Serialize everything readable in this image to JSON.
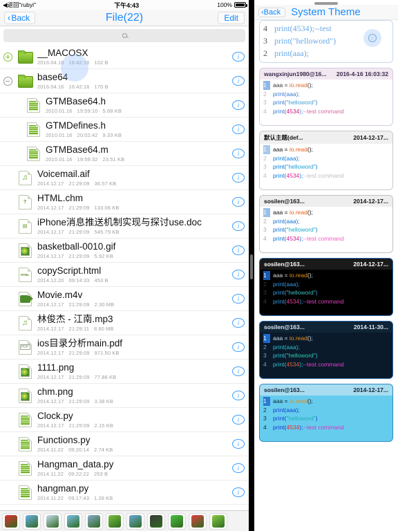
{
  "status_bar": {
    "back_label": "◀返回\"rubyi\"",
    "time": "下午4:43",
    "battery": "100%"
  },
  "left": {
    "nav": {
      "back": "Back",
      "title": "File(22)",
      "edit": "Edit"
    },
    "search": {
      "placeholder": "",
      "icon": "search-icon"
    },
    "files": [
      {
        "name": "__MACOSX",
        "date": "2016.04.16",
        "time": "16:42:16",
        "size": "102 B",
        "icon": "folder-icon",
        "toggle": "plus",
        "indent": 0
      },
      {
        "name": "base64",
        "date": "2016.04.16",
        "time": "16:42:16",
        "size": "170 B",
        "icon": "folder-icon",
        "toggle": "minus",
        "indent": 0
      },
      {
        "name": "GTMBase64.h",
        "date": "2010.01.16",
        "time": "19:59:10",
        "size": "5.68 KB",
        "icon": "code-file-icon",
        "toggle": "",
        "indent": 1
      },
      {
        "name": "GTMDefines.h",
        "date": "2010.01.16",
        "time": "20:02:42",
        "size": "9.33 KB",
        "icon": "code-file-icon",
        "toggle": "",
        "indent": 1
      },
      {
        "name": "GTMBase64.m",
        "date": "2010.01.16",
        "time": "19:59:32",
        "size": "23.51 KB",
        "icon": "code-file-icon",
        "toggle": "",
        "indent": 1
      },
      {
        "name": "Voicemail.aif",
        "date": "2014.12.17",
        "time": "21:29:09",
        "size": "36.57 KB",
        "icon": "audio-file-icon",
        "toggle": "",
        "indent": 0
      },
      {
        "name": "HTML.chm",
        "date": "2014.12.17",
        "time": "21:29:09",
        "size": "133.06 KB",
        "icon": "chm-file-icon",
        "toggle": "",
        "indent": 0
      },
      {
        "name": "iPhone消息推送机制实现与探讨use.doc",
        "date": "2014.12.17",
        "time": "21:29:09",
        "size": "545.79 KB",
        "icon": "doc-file-icon",
        "toggle": "",
        "indent": 0
      },
      {
        "name": "basketball-0010.gif",
        "date": "2014.12.17",
        "time": "21:29:09",
        "size": "5.92 KB",
        "icon": "image-file-icon",
        "toggle": "",
        "indent": 0
      },
      {
        "name": "copyScript.html",
        "date": "2014.12.20",
        "time": "09:14:33",
        "size": "453 B",
        "icon": "html-file-icon",
        "toggle": "",
        "indent": 0
      },
      {
        "name": "Movie.m4v",
        "date": "2014.12.17",
        "time": "21:29:09",
        "size": "2.30 MB",
        "icon": "video-file-icon",
        "toggle": "",
        "indent": 0
      },
      {
        "name": "林俊杰 - 江南.mp3",
        "date": "2014.12.17",
        "time": "21:29:11",
        "size": "8.60 MB",
        "icon": "audio-file-icon",
        "toggle": "",
        "indent": 0
      },
      {
        "name": "ios目录分析main.pdf",
        "date": "2014.12.17",
        "time": "21:29:09",
        "size": "971.50 KB",
        "icon": "pdf-file-icon",
        "toggle": "",
        "indent": 0
      },
      {
        "name": "1111.png",
        "date": "2014.12.17",
        "time": "21:29:09",
        "size": "77.88 KB",
        "icon": "image-file-icon",
        "toggle": "",
        "indent": 0
      },
      {
        "name": "chm.png",
        "date": "2014.12.17",
        "time": "21:29:09",
        "size": "3.38 KB",
        "icon": "image-file-icon",
        "toggle": "",
        "indent": 0
      },
      {
        "name": "Clock.py",
        "date": "2014.12.17",
        "time": "21:29:09",
        "size": "2.15 KB",
        "icon": "code-file-icon",
        "toggle": "",
        "indent": 0
      },
      {
        "name": "Functions.py",
        "date": "2014.11.22",
        "time": "09:20:14",
        "size": "2.74 KB",
        "icon": "code-file-icon",
        "toggle": "",
        "indent": 0
      },
      {
        "name": "Hangman_data.py",
        "date": "2014.11.22",
        "time": "09:22:22",
        "size": "253 B",
        "icon": "code-file-icon",
        "toggle": "",
        "indent": 0
      },
      {
        "name": "hangman.py",
        "date": "2014.11.22",
        "time": "09:17:43",
        "size": "1.28 KB",
        "icon": "code-file-icon",
        "toggle": "",
        "indent": 0
      }
    ],
    "info_button_label": "i",
    "toolbar": [
      {
        "name": "sort-az-button",
        "glyph": "A\nZ"
      },
      {
        "name": "new-folder-button",
        "glyph": ""
      },
      {
        "name": "new-file-button",
        "glyph": ""
      },
      {
        "name": "photo-import-button",
        "glyph": ""
      },
      {
        "name": "scanner-button",
        "glyph": ""
      },
      {
        "name": "flashlight-button",
        "glyph": ""
      },
      {
        "name": "camera-button",
        "glyph": ""
      },
      {
        "name": "archive-button",
        "glyph": ""
      },
      {
        "name": "download-button",
        "glyph": ""
      },
      {
        "name": "trash-button",
        "glyph": ""
      },
      {
        "name": "settings-button",
        "glyph": ""
      }
    ]
  },
  "right": {
    "nav": {
      "back": "Back",
      "title": "System Theme"
    },
    "partial_card": {
      "lines": [
        {
          "no": "2",
          "text": "print(aaa);"
        },
        {
          "no": "3",
          "text": "print(\"helloword\")"
        },
        {
          "no": "4",
          "text": "print(4534);--test"
        }
      ],
      "lock_icon": "lock-icon"
    },
    "code": {
      "l1_a": "aaa = ",
      "l1_b": "io.read",
      "l1_c": "();",
      "l2": "print(aaa);",
      "l3_a": "print(",
      "l3_b": "\"helloword\"",
      "l3_c": ")",
      "l4_a": "print(",
      "l4_b": "4534",
      "l4_c": ");",
      "l4_d": "--test command",
      "nums": [
        "1",
        "2",
        "3",
        "4"
      ]
    },
    "themes": [
      {
        "name": "wangxinjun1980@16...",
        "date": "2016-4-16 16:03:32",
        "bg": "#ffffff",
        "head_bg": "#f2e8f2",
        "card_bg": "#fdf0f6",
        "border": "#d8c8e0",
        "head_color": "#3a2a4a",
        "num_color": "#c9a9c9",
        "sel_bg": "#8fb8e8",
        "text": "#333333",
        "keyword": "#3a7ad0",
        "func": "#d04a9a",
        "string": "#4aa0d0",
        "number": "#d01a7a",
        "comment": "#d06aa0",
        "ident": "#333333",
        "io_color": "#d06a2a"
      },
      {
        "name": "默认主题(def...",
        "date": "2014-12-17...",
        "bg": "#ffffff",
        "head_bg": "#f0f0f0",
        "card_bg": "#ffffff",
        "border": "#c8c8c8",
        "head_color": "#111111",
        "num_color": "#bbbbbb",
        "sel_bg": "#a8c8ea",
        "text": "#111111",
        "keyword": "#0a7ad8",
        "func": "#0a7ad8",
        "string": "#1aa0d8",
        "number": "#e0208a",
        "comment": "#c0c0c0",
        "ident": "#111111",
        "io_color": "#e0601a"
      },
      {
        "name": "sosilen@163...",
        "date": "2014-12-17...",
        "bg": "#ffffff",
        "head_bg": "#eeeeee",
        "card_bg": "#f2f2f2",
        "border": "#c0c0c0",
        "head_color": "#111111",
        "num_color": "#aaaaaa",
        "sel_bg": "#9ac0e8",
        "text": "#111111",
        "keyword": "#1070d0",
        "func": "#1070d0",
        "string": "#20a8c8",
        "number": "#d0208a",
        "comment": "#f060c0",
        "ident": "#111111",
        "io_color": "#e0601a"
      },
      {
        "name": "sosilen@163...",
        "date": "2014-12-17...",
        "bg": "#000000",
        "head_bg": "#1a1a1a",
        "card_bg": "#0a0a0a",
        "border": "#2a6ab0",
        "head_color": "#ffffff",
        "num_color": "#3a3a3a",
        "sel_bg": "#1a5ab0",
        "text": "#dddddd",
        "keyword": "#3a9ae0",
        "func": "#3a9ae0",
        "string": "#40c0c0",
        "number": "#e04090",
        "comment": "#e040c0",
        "ident": "#dddddd",
        "io_color": "#e09020"
      },
      {
        "name": "sosilen@163...",
        "date": "2014-11-30...",
        "bg": "#0a1a2a",
        "head_bg": "#0f2435",
        "card_bg": "#0a1a2a",
        "border": "#2a6ab0",
        "head_color": "#dbe8f5",
        "num_color": "#70a0c0",
        "sel_bg": "#1a6ad0",
        "text": "#c8dce8",
        "keyword": "#30c0d0",
        "func": "#30c0d0",
        "string": "#30c8b0",
        "number": "#e06040",
        "comment": "#e040d0",
        "ident": "#c8dce8",
        "io_color": "#e09020"
      },
      {
        "name": "sosilen@163...",
        "date": "2014-12-17...",
        "bg": "#66ccee",
        "head_bg": "#a8dcf0",
        "card_bg": "#66ccee",
        "border": "#2a8ac0",
        "head_color": "#102030",
        "num_color": "#103040",
        "sel_bg": "#2a7ad0",
        "text": "#102030",
        "keyword": "#1040d0",
        "func": "#1040d0",
        "string": "#20b0b0",
        "number": "#e03030",
        "comment": "#e030c0",
        "ident": "#102030",
        "io_color": "#e09020"
      }
    ]
  }
}
